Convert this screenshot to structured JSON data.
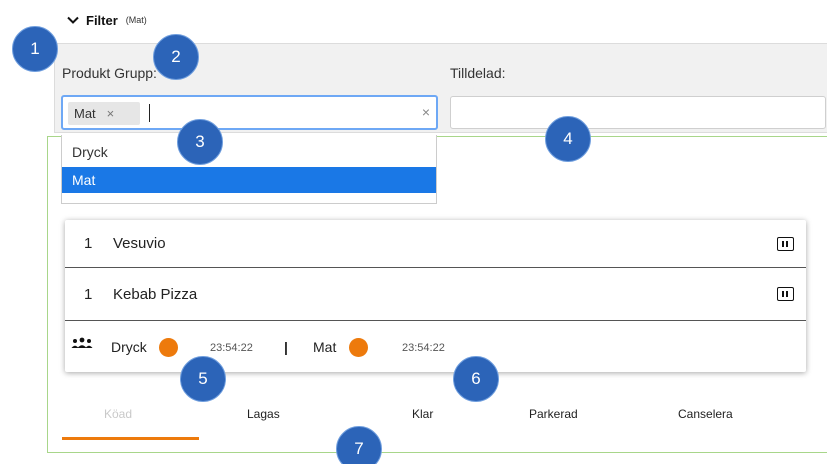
{
  "filter": {
    "title": "Filter",
    "subtitle": "(Mat)",
    "icon": "chevron-down-icon"
  },
  "fields": {
    "produkt_label": "Produkt Grupp:",
    "tilldelad_label": "Tilldelad:",
    "selected_chip": "Mat",
    "chip_remove": "×",
    "clear": "×"
  },
  "dropdown": {
    "options": [
      "Dryck",
      "Mat"
    ],
    "highlighted": "Mat"
  },
  "orders": [
    {
      "qty": "1",
      "name": "Vesuvio"
    },
    {
      "qty": "1",
      "name": "Kebab Pizza"
    }
  ],
  "status": {
    "icon": "people-icon",
    "separator": "|",
    "groups": [
      {
        "label": "Dryck",
        "time": "23:54:22",
        "color": "#ed7a0c"
      },
      {
        "label": "Mat",
        "time": "23:54:22",
        "color": "#ed7a0c"
      }
    ]
  },
  "tabs": [
    {
      "label": "Köad",
      "active": true
    },
    {
      "label": "Lagas",
      "active": false
    },
    {
      "label": "Klar",
      "active": false
    },
    {
      "label": "Parkerad",
      "active": false
    },
    {
      "label": "Canselera",
      "active": false
    }
  ],
  "badges": [
    "1",
    "2",
    "3",
    "4",
    "5",
    "6",
    "7"
  ],
  "colors": {
    "accent": "#ed7a0c",
    "selection": "#1a78e6",
    "badge": "#2c64b8",
    "panel_border": "#a8d68a",
    "focus_border": "#6ea8f5"
  }
}
